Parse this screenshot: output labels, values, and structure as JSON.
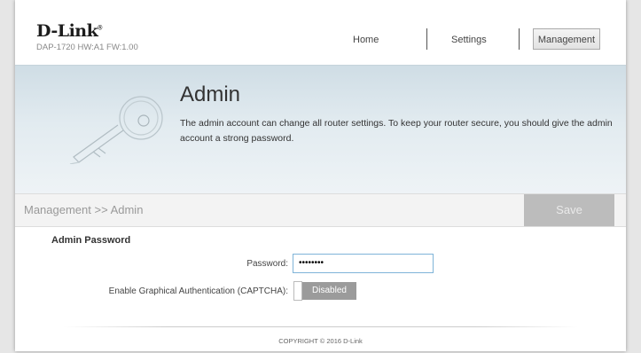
{
  "header": {
    "brand": "D-Link",
    "registered_mark": "®",
    "model_info": "DAP-1720 HW:A1 FW:1.00",
    "nav": {
      "home_label": "Home",
      "settings_label": "Settings",
      "management_label": "Management",
      "active": "Management"
    }
  },
  "banner": {
    "icon": "key-icon",
    "title": "Admin",
    "description": "The admin account can change all router settings. To keep your router secure, you should give the admin account a strong password."
  },
  "breadcrumb": {
    "text": "Management >> Admin",
    "save_label": "Save"
  },
  "form": {
    "section_title": "Admin Password",
    "password_label": "Password:",
    "password_value": "••••••••",
    "captcha_label": "Enable Graphical Authentication (CAPTCHA):",
    "captcha_state": "Disabled"
  },
  "footer": {
    "copyright": "COPYRIGHT © 2016 D-Link"
  },
  "colors": {
    "banner_gradient_top": "#cfdde5",
    "save_button_bg": "#bcbcbc",
    "toggle_bg": "#9b9b9b",
    "input_border": "#7fb4d8"
  }
}
